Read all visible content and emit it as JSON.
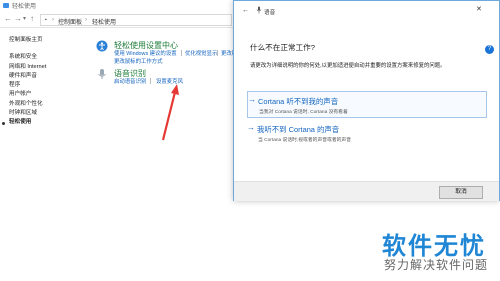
{
  "window": {
    "title": "轻松使用"
  },
  "address_bar": {
    "crumbs": [
      "控制面板",
      "轻松使用"
    ]
  },
  "sidebar": {
    "home": "控制面板主页",
    "items": [
      "系统和安全",
      "网络和 Internet",
      "硬件和声音",
      "程序",
      "用户帐户",
      "外观和个性化",
      "时钟和区域"
    ],
    "current": "轻松使用"
  },
  "ease_center": {
    "title": "轻松使用设置中心",
    "links": [
      "使用 Windows 建议的设置",
      "优化视觉显示",
      "更改鼠标的工作方式"
    ],
    "link_right": "更改键盘的工作方式"
  },
  "speech": {
    "title": "语音识别",
    "links": [
      "启动语音识别",
      "设置麦克风"
    ]
  },
  "dialog": {
    "title": "语音",
    "question": "什么不在正常工作?",
    "description": "请更改为详细说明的你的何处,以更加适进便自动并重要的设置方案来修复的问题。",
    "options": [
      {
        "title": "Cortana 听不到我的声音",
        "subtitle": "当我对 Cortana 说话时, Cortana 没有看着"
      },
      {
        "title": "我听不到 Cortana 的声音",
        "subtitle": "当 Cortana 说话时,视或者的声音或者的声音"
      }
    ],
    "cancel_label": "取消"
  },
  "help_icon": "?",
  "watermark": {
    "main": "软件无忧",
    "sub": "努力解决软件问题"
  },
  "colors": {
    "link": "#1565c0",
    "section_title": "#1e7c3a",
    "watermark": "#1f86d6",
    "arrow": "#e53935"
  }
}
